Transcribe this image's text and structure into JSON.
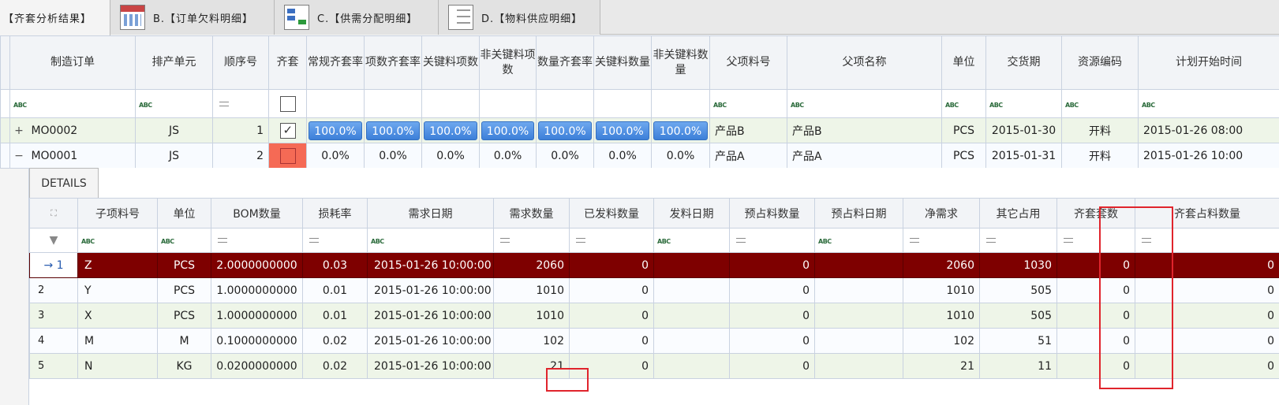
{
  "tabs": [
    {
      "label": "【齐套分析结果】",
      "icon": ""
    },
    {
      "label": "B.【订单欠料明细】",
      "icon": "calendar-grid-icon"
    },
    {
      "label": "C.【供需分配明细】",
      "icon": "flowchart-icon"
    },
    {
      "label": "D.【物料供应明细】",
      "icon": "numbered-list-icon"
    }
  ],
  "master": {
    "columns": [
      "制造订单",
      "排产单元",
      "顺序号",
      "齐套",
      "常规齐套率",
      "项数齐套率",
      "关键料项数",
      "非关键料项数",
      "数量齐套率",
      "关键料数量",
      "非关键料数量",
      "父项料号",
      "父项名称",
      "单位",
      "交货期",
      "资源编码",
      "计划开始时间"
    ],
    "rows": [
      {
        "expander": "+",
        "order": "MO0002",
        "unit": "JS",
        "seq": "1",
        "complete": true,
        "r1": "100.0%",
        "r2": "100.0%",
        "r3": "100.0%",
        "r4": "100.0%",
        "r5": "100.0%",
        "r6": "100.0%",
        "r7": "100.0%",
        "parent_code": "产品B",
        "parent_name": "产品B",
        "uom": "PCS",
        "delivery": "2015-01-30",
        "resource": "开料",
        "start": "2015-01-26 08:00"
      },
      {
        "expander": "−",
        "order": "MO0001",
        "unit": "JS",
        "seq": "2",
        "complete": false,
        "r1": "0.0%",
        "r2": "0.0%",
        "r3": "0.0%",
        "r4": "0.0%",
        "r5": "0.0%",
        "r6": "0.0%",
        "r7": "0.0%",
        "parent_code": "产品A",
        "parent_name": "产品A",
        "uom": "PCS",
        "delivery": "2015-01-31",
        "resource": "开料",
        "start": "2015-01-26 10:00"
      }
    ]
  },
  "detail": {
    "tab_label": "DETAILS",
    "columns": [
      "子项料号",
      "单位",
      "BOM数量",
      "损耗率",
      "需求日期",
      "需求数量",
      "已发料数量",
      "发料日期",
      "预占料数量",
      "预占料日期",
      "净需求",
      "其它占用",
      "齐套套数",
      "齐套占料数量"
    ],
    "rows": [
      {
        "ind": "→ 1",
        "item": "Z",
        "uom": "PCS",
        "bom": "2.0000000000",
        "loss": "0.03",
        "date": "2015-01-26 10:00:00",
        "qty": "2060",
        "issued": "0",
        "issue_date": "",
        "reserved": "0",
        "reserve_date": "",
        "net": "2060",
        "other": "1030",
        "sets": "0",
        "setqty": "0"
      },
      {
        "ind": "2",
        "item": "Y",
        "uom": "PCS",
        "bom": "1.0000000000",
        "loss": "0.01",
        "date": "2015-01-26 10:00:00",
        "qty": "1010",
        "issued": "0",
        "issue_date": "",
        "reserved": "0",
        "reserve_date": "",
        "net": "1010",
        "other": "505",
        "sets": "0",
        "setqty": "0"
      },
      {
        "ind": "3",
        "item": "X",
        "uom": "PCS",
        "bom": "1.0000000000",
        "loss": "0.01",
        "date": "2015-01-26 10:00:00",
        "qty": "1010",
        "issued": "0",
        "issue_date": "",
        "reserved": "0",
        "reserve_date": "",
        "net": "1010",
        "other": "505",
        "sets": "0",
        "setqty": "0"
      },
      {
        "ind": "4",
        "item": "M",
        "uom": "M",
        "bom": "0.1000000000",
        "loss": "0.02",
        "date": "2015-01-26 10:00:00",
        "qty": "102",
        "issued": "0",
        "issue_date": "",
        "reserved": "0",
        "reserve_date": "",
        "net": "102",
        "other": "51",
        "sets": "0",
        "setqty": "0"
      },
      {
        "ind": "5",
        "item": "N",
        "uom": "KG",
        "bom": "0.0200000000",
        "loss": "0.02",
        "date": "2015-01-26 10:00:00",
        "qty": "21",
        "issued": "0",
        "issue_date": "",
        "reserved": "0",
        "reserve_date": "",
        "net": "21",
        "other": "11",
        "sets": "0",
        "setqty": "0"
      }
    ]
  },
  "highlight_color": "#e0242c",
  "selected_row_color": "#7e0000"
}
